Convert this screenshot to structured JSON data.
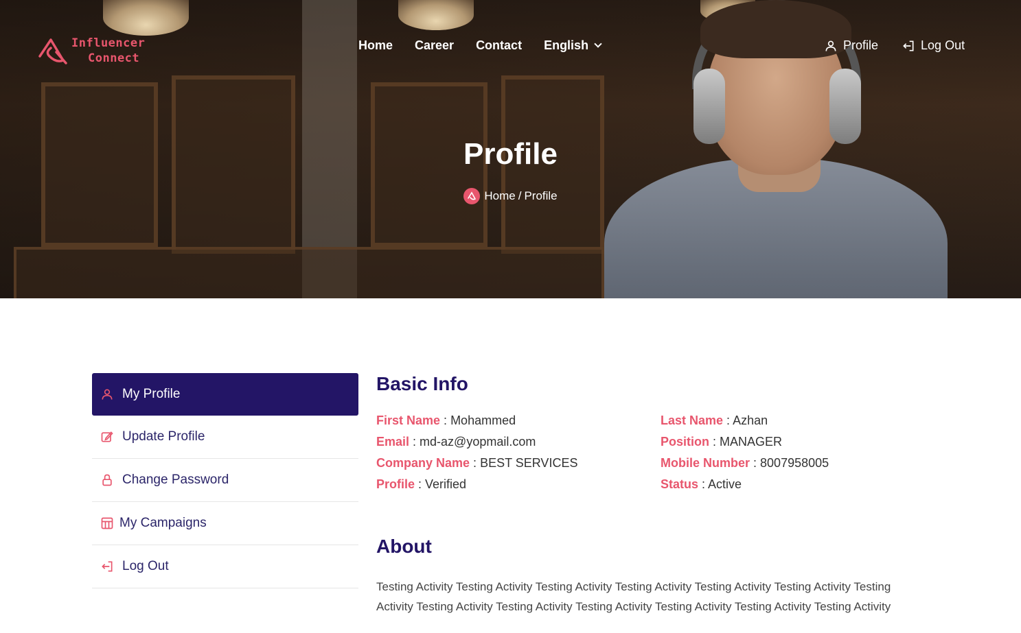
{
  "brand": {
    "line1": "Influencer",
    "line2": "Connect",
    "accent": "#e8566d"
  },
  "nav": {
    "items": [
      {
        "label": "Home"
      },
      {
        "label": "Career"
      },
      {
        "label": "Contact"
      },
      {
        "label": "English"
      }
    ],
    "profile_label": "Profile",
    "logout_label": "Log Out"
  },
  "hero": {
    "title": "Profile",
    "breadcrumb": {
      "home": "Home",
      "sep": "/",
      "current": "Profile"
    }
  },
  "sidebar": {
    "items": [
      {
        "label": "My Profile",
        "icon": "user-icon",
        "active": true
      },
      {
        "label": "Update Profile",
        "icon": "edit-icon"
      },
      {
        "label": "Change Password",
        "icon": "lock-icon"
      },
      {
        "label": "My Campaigns",
        "icon": "campaign-icon"
      },
      {
        "label": "Log Out",
        "icon": "logout-icon"
      }
    ],
    "active_color": "#231566"
  },
  "basic_info": {
    "title": "Basic Info",
    "fields": {
      "first_name": {
        "label": "First Name",
        "value": "Mohammed"
      },
      "last_name": {
        "label": "Last Name",
        "value": "Azhan"
      },
      "email": {
        "label": "Email",
        "value": "md-az@yopmail.com"
      },
      "position": {
        "label": "Position",
        "value": "MANAGER"
      },
      "company_name": {
        "label": "Company Name",
        "value": "BEST SERVICES"
      },
      "mobile_number": {
        "label": "Mobile Number",
        "value": "8007958005"
      },
      "profile": {
        "label": "Profile",
        "value": "Verified"
      },
      "status": {
        "label": "Status",
        "value": "Active"
      }
    }
  },
  "about": {
    "title": "About",
    "text": "Testing Activity Testing Activity Testing Activity Testing Activity Testing Activity Testing Activity Testing Activity Testing Activity Testing Activity Testing Activity Testing Activity Testing Activity Testing Activity"
  }
}
